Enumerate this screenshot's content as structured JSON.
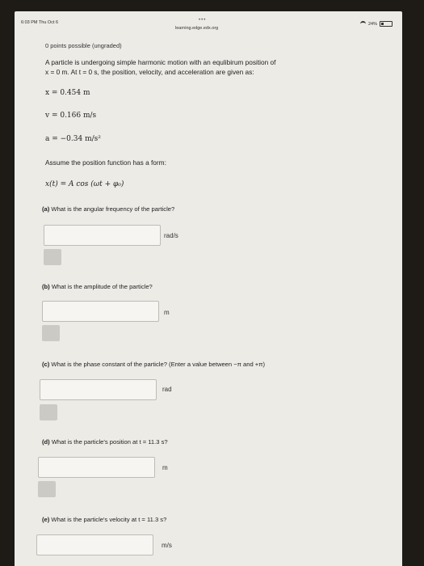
{
  "status": {
    "time": "6:03 PM   Thu Oct 6",
    "dots": "•••",
    "url": "learning.edge.edx.org",
    "battery": "24%"
  },
  "problem": {
    "points": "0 points possible (ungraded)",
    "intro_1": "A particle is undergoing simple harmonic motion with an equlibirum position of",
    "intro_2": "x = 0 m. At t = 0 s, the position, velocity, and acceleration are given as:",
    "x0": "x = 0.454 m",
    "v0": "v = 0.166 m/s",
    "a0": "a = −0.34 m/s²",
    "assume": "Assume the position function has a form:",
    "form": "x(t) = A cos (ωt + φ₀)"
  },
  "questions": [
    {
      "label": "(a)",
      "text": "What is the angular frequency of the particle?",
      "unit": "rad/s",
      "value": ""
    },
    {
      "label": "(b)",
      "text": "What is the amplitude of the particle?",
      "unit": "m",
      "value": ""
    },
    {
      "label": "(c)",
      "text": "What is the phase constant of the particle? (Enter a value between −π and +π)",
      "unit": "rad",
      "value": ""
    },
    {
      "label": "(d)",
      "text": "What is the particle's position at t = 11.3 s?",
      "unit": "m",
      "value": ""
    },
    {
      "label": "(e)",
      "text": "What is the particle's velocity at t = 11.3 s?",
      "unit": "m/s",
      "value": ""
    }
  ]
}
